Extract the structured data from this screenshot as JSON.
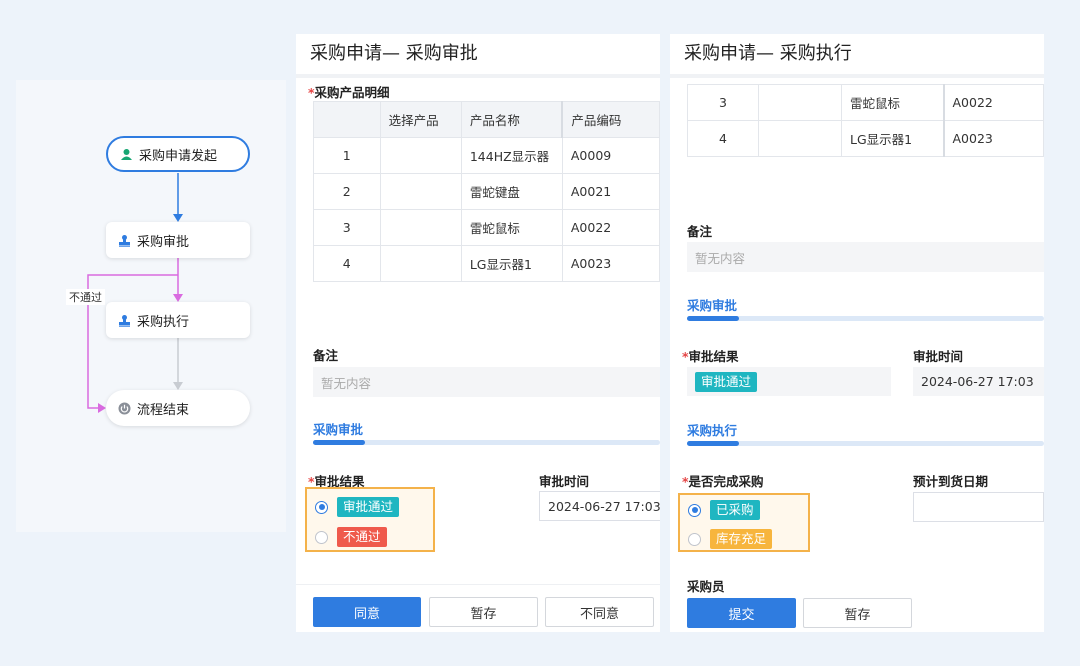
{
  "flow": {
    "nodes": {
      "start": "采购申请发起",
      "approve": "采购审批",
      "exec": "采购执行",
      "end": "流程结束"
    },
    "reject_label": "不通过",
    "colors": {
      "main": "#2f7ce0",
      "reject": "#d96be0",
      "inactive": "#c8ccd2"
    },
    "icons": {
      "start": "user-icon",
      "approve": "stamp-icon",
      "exec": "stamp-icon",
      "end": "power-icon"
    }
  },
  "approval_card": {
    "title": "采购申请— 采购审批",
    "products_label": "采购产品明细",
    "columns": [
      "",
      "选择产品",
      "产品名称",
      "产品编码"
    ],
    "rows": [
      {
        "no": "1",
        "select": "",
        "name": "144HZ显示器",
        "code": "A0009"
      },
      {
        "no": "2",
        "select": "",
        "name": "雷蛇键盘",
        "code": "A0021"
      },
      {
        "no": "3",
        "select": "",
        "name": "雷蛇鼠标",
        "code": "A0022"
      },
      {
        "no": "4",
        "select": "",
        "name": "LG显示器1",
        "code": "A0023"
      }
    ],
    "remark_label": "备注",
    "remark_value": "暂无内容",
    "section_title": "采购审批",
    "result_label": "审批结果",
    "result_options": [
      "审批通过",
      "不通过"
    ],
    "result_selected": "审批通过",
    "time_label": "审批时间",
    "time_value": "2024-06-27 17:03",
    "buttons": {
      "agree": "同意",
      "save": "暂存",
      "disagree": "不同意"
    }
  },
  "exec_card": {
    "title": "采购申请— 采购执行",
    "rows": [
      {
        "no": "3",
        "select": "",
        "name": "雷蛇鼠标",
        "code": "A0022"
      },
      {
        "no": "4",
        "select": "",
        "name": "LG显示器1",
        "code": "A0023"
      }
    ],
    "remark_label": "备注",
    "remark_value": "暂无内容",
    "approval_section": "采购审批",
    "result_label": "审批结果",
    "result_value": "审批通过",
    "time_label": "审批时间",
    "time_value": "2024-06-27 17:03",
    "exec_section": "采购执行",
    "done_label": "是否完成采购",
    "done_options": [
      "已采购",
      "库存充足"
    ],
    "done_selected": "已采购",
    "eta_label": "预计到货日期",
    "eta_value": "",
    "buyer_label": "采购员",
    "buttons": {
      "submit": "提交",
      "save": "暂存"
    }
  }
}
